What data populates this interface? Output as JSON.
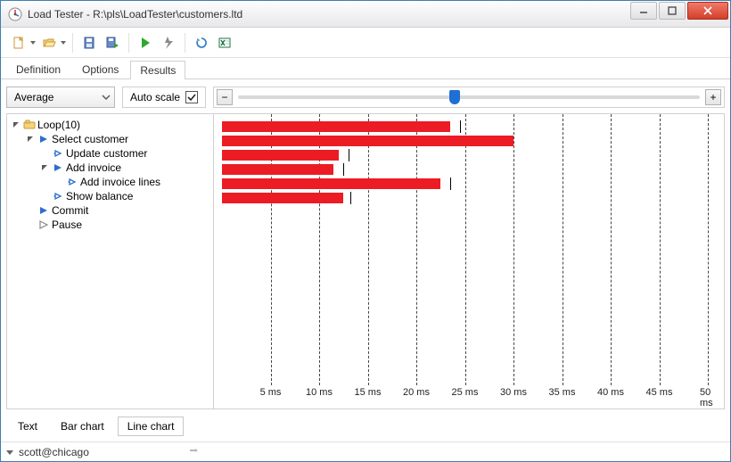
{
  "window": {
    "title": "Load Tester - R:\\pls\\LoadTester\\customers.ltd"
  },
  "tabs": {
    "definition": "Definition",
    "options": "Options",
    "results": "Results",
    "active": "results"
  },
  "controls": {
    "aggregate_label": "Average",
    "autoscale_label": "Auto scale",
    "autoscale_checked": true,
    "zoom_minus": "−",
    "zoom_plus": "+",
    "zoom_pos_pct": 47
  },
  "tree": {
    "root": "Loop(10)",
    "items": {
      "select": "Select customer",
      "update": "Update customer",
      "addinv": "Add invoice",
      "addlines": "Add invoice lines",
      "showbal": "Show balance",
      "commit": "Commit",
      "pause": "Pause"
    }
  },
  "chart_data": {
    "type": "bar",
    "unit": "ms",
    "x_ticks": [
      5,
      10,
      15,
      20,
      25,
      30,
      35,
      40,
      45,
      50
    ],
    "series": [
      {
        "name": "Select customer",
        "value": 23.5,
        "marker": 24.5
      },
      {
        "name": "Update customer",
        "value": 30.0,
        "marker": null
      },
      {
        "name": "Add invoice",
        "value": 12.0,
        "marker": 13.0
      },
      {
        "name": "Add invoice lines",
        "value": 11.5,
        "marker": 12.5
      },
      {
        "name": "Show balance",
        "value": 22.5,
        "marker": 23.5
      },
      {
        "name": "Commit",
        "value": 12.5,
        "marker": 13.2
      },
      {
        "name": "Pause",
        "value": null,
        "marker": null
      }
    ],
    "xlabel": "",
    "ylabel": "",
    "title": ""
  },
  "bottom_tabs": {
    "text": "Text",
    "bar": "Bar chart",
    "line": "Line chart",
    "active": "line"
  },
  "status": {
    "user": "scott@chicago"
  },
  "colors": {
    "bar": "#ec1c24",
    "accent": "#1e6fd6"
  }
}
